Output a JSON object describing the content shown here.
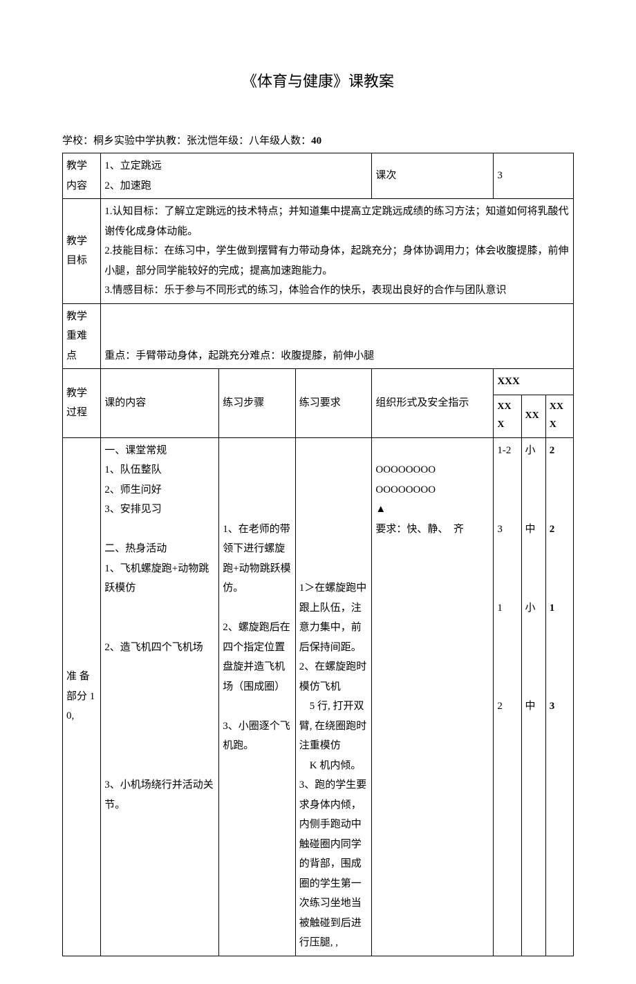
{
  "title": "《体育与健康》课教案",
  "meta": {
    "school_label": "学校：",
    "school": "桐乡实验中学",
    "teacher_label": "执教：",
    "teacher": "张沈恺",
    "grade_label": "年级：",
    "grade": "八年级",
    "count_label": "人数：",
    "count": "40"
  },
  "r1": {
    "label": "教学内容",
    "content": "1、立定跳远\n2、加速跑",
    "keci_label": "课次",
    "keci_val": "3"
  },
  "r2": {
    "label": "教学目标",
    "content": "1.认知目标：了解立定跳远的技术特点；并知道集中提高立定跳远成绩的练习方法；知道如何将乳酸代谢传化成身体动能。\n2.技能目标：在练习中，学生做到摆臂有力带动身体，起跳充分；身体协调用力；体会收腹提膝，前伸小腿，部分同学能较好的完成；提高加速跑能力。\n3.情感目标：乐于参与不同形式的练习，体验合作的快乐，表现出良好的合作与团队意识"
  },
  "r3": {
    "label": "教学重难点",
    "content": "重点：手臂带动身体，起跳充分难点：收腹提膝，前伸小腿"
  },
  "hdr": {
    "c1": "教学过程",
    "c2": "课的内容",
    "c3": "练习步骤",
    "c4": "练习要求",
    "c5": "组织形式及安全指示",
    "c6": "XXX",
    "c6a": "XXX",
    "c6b": "XX",
    "c6c": "XXX"
  },
  "prep": {
    "label": "准 备 部分 10,",
    "col2": "一、课堂常规\n1、队伍整队\n2、师生问好\n3、安排见习\n\n二、热身活动\n1、飞机螺旋跑+动物跳跃模仿\n\n\n2、造飞机四个飞机场\n\n\n\n\n\n\n3、小机场绕行并活动关节。",
    "col3": "\n\n\n\n1、在老师的带领下进行螺旋跑+动物跳跃模仿。\n\n2、螺旋跑后在四个指定位置盘旋并造飞机场（围成圈）\n\n3、小圈逐个飞机跑。",
    "col4": "\n\n\n\n\n\n\n1＞在螺旋跑中跟上队伍，注意力集中，前后保持间距。\n2、在螺旋跑时模仿飞机\n　5 行, 打开双臂, 在绕圈跑时注重模仿\n　K 机内倾。\n3、跑的学生要求身体内倾，内侧手跑动中触碰圈内同学的背部，围成圈的学生第一次练习坐地当被触碰到后进行压腿, ,",
    "col5": "\nOOOOOOOO\nOOOOOOOO\n▲\n要求：快、静、　齐",
    "col6a": "1-2\n\n\n\n3\n\n\n\n1\n\n\n\n\n2",
    "col6b": "小\n\n\n\n中\n\n\n\n小\n\n\n\n\n中",
    "col6c": "2\n\n\n\n2\n\n\n\n1\n\n\n\n\n3"
  }
}
